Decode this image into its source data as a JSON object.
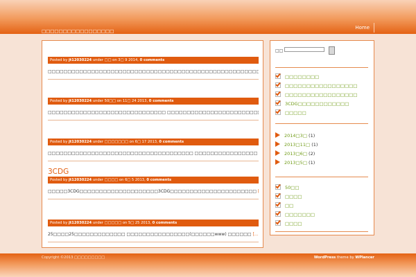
{
  "header": {
    "tagline": "□□□□□□□□□□□□□□□□□",
    "nav_home": "Home"
  },
  "posts": [
    {
      "title": "",
      "posted_by": "Posted by",
      "author": "jt12030224",
      "under": "under",
      "category": "□□",
      "on": "on",
      "date": "3□ 9 2014",
      "comments": "0 comments",
      "excerpt": "□□□□□□□□□□□□□□□□□□□□□□□□□□□□□□□□□□□□□□□□□□□□□□□□□□□□□□□□",
      "more": "[...]"
    },
    {
      "title": "",
      "posted_by": "Posted by",
      "author": "jt12030224",
      "under": "under",
      "category": "50□□",
      "on": "on",
      "date": "11□ 24 2013",
      "comments": "0 comments",
      "excerpt": "□□□□□□□□□□□□□□□□□□□□□□□□□□□□□□ □□□□□□□□□□□□□□□□□□□□□□□□",
      "more": "[...]"
    },
    {
      "title": "",
      "posted_by": "Posted by",
      "author": "jt12030224",
      "under": "under",
      "category": "□□□□□□□",
      "on": "on",
      "date": "6□ 17 2013",
      "comments": "0 comments",
      "excerpt": "□□□□□□□□□□□□□□□□□□□□□□□□□□□□□□□□□□□□□ □□□□□□□□□□□□□□□□",
      "more": "[...]"
    },
    {
      "title": "3CDG",
      "posted_by": "Posted by",
      "author": "jt12030224",
      "under": "under",
      "category": "□□□□",
      "on": "on",
      "date": "6□ 5 2013",
      "comments": "0 comments",
      "excerpt": "□□□□□3CDG□□□□□□□□□□□□□□□□□□□□3CDG□□□□□□□□□□□□□□□□□□□□□□",
      "more": "[...]"
    },
    {
      "title": "",
      "posted_by": "Posted by",
      "author": "jt12030224",
      "under": "under",
      "category": "□□□□□",
      "on": "on",
      "date": "5□ 25 2013",
      "comments": "0 comments",
      "excerpt": "25□□□□25□□□□□□□□□□□□□ □□□□□□□□□□□□□□□□(□□□□□□www) □□□□□□",
      "more": "[...]"
    }
  ],
  "sidebar": {
    "search_label": "□□",
    "search_value": "",
    "recent_posts": [
      "□□□□□□□□",
      "□□□□□□□□□□□□□□□□□",
      "□□□□□□□□□□□□□□□□□",
      "3CDG□□□□□□□□□□□□",
      "□□□□□"
    ],
    "archives": [
      {
        "label": "2014□3□",
        "count": "(1)"
      },
      {
        "label": "2013□11□",
        "count": "(1)"
      },
      {
        "label": "2013□6□",
        "count": "(2)"
      },
      {
        "label": "2013□5□",
        "count": "(1)"
      }
    ],
    "categories": [
      "50□□",
      "□□□□",
      "□□",
      "□□□□□□□",
      "□□□□"
    ]
  },
  "footer": {
    "copyright": "Copyright ©2013 □□□□□□□□□",
    "credit_brand": "WordPress",
    "credit_text": "theme by",
    "credit_author": "WPlancer"
  },
  "colors": {
    "accent": "#e05b0f",
    "link": "#6e9a13",
    "background": "#f7e3d6"
  },
  "icons": {
    "recent_posts": "checkbox-check-icon",
    "archives": "arrow-icon",
    "categories": "checkbox-check-icon"
  }
}
